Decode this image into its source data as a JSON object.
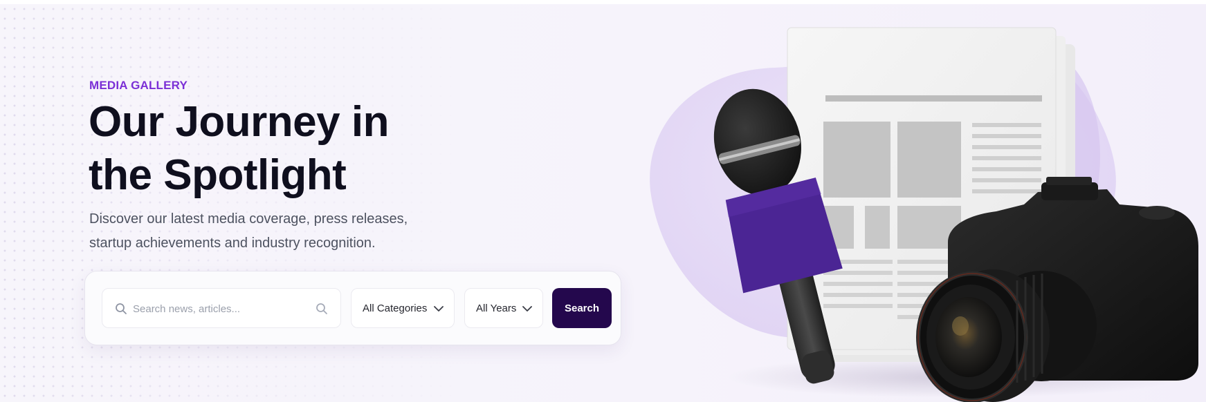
{
  "hero": {
    "eyebrow": "MEDIA GALLERY",
    "title_line1": "Our Journey in",
    "title_line2": "the Spotlight",
    "subtitle_line1": "Discover our latest media coverage, press releases,",
    "subtitle_line2": "startup achievements and industry recognition."
  },
  "search": {
    "placeholder": "Search news, articles...",
    "value": "",
    "category_selected": "All Categories",
    "year_selected": "All Years",
    "button_label": "Search"
  },
  "icons": {
    "search": "search-icon",
    "chevron": "chevron-down-icon"
  },
  "colors": {
    "accent": "#7b2fd6",
    "button": "#24084d",
    "title": "#0f0f1e",
    "mic_flag": "#4b2594"
  }
}
